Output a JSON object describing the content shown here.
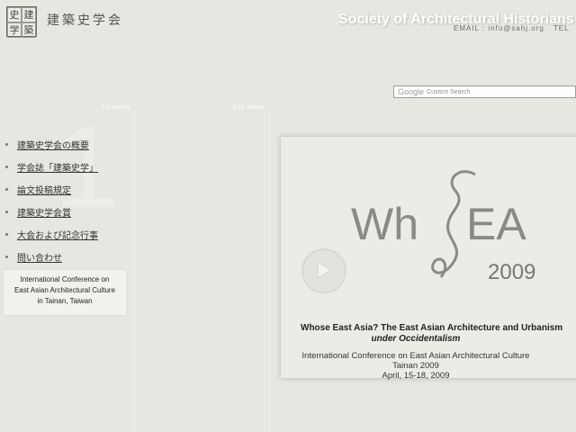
{
  "header": {
    "logo_chars": [
      "史",
      "建",
      "学",
      "築"
    ],
    "site_name": "建築史学会",
    "english_title": "Society of Architectural Historians",
    "email": "EMAIL : info@sahj.org",
    "tel_label": "TEL"
  },
  "search": {
    "brand": "Google",
    "placeholder": "Custom Search"
  },
  "menus": {
    "first_label": "1st menu",
    "second_label": "2nd menu",
    "big_number": "1"
  },
  "nav": {
    "items": [
      "建築史学会の概要",
      "学会誌「建築史学」",
      "論文投稿規定",
      "建築史学会賞",
      "大会および記念行事",
      "問い合わせ"
    ]
  },
  "conference_box": {
    "line1": "International Conference on",
    "line2": "East Asian Architectural Culture",
    "line3": "in Tainan, Taiwan"
  },
  "banner": {
    "logo_text_left": "Wh",
    "logo_text_right": "EA",
    "logo_year": "2009",
    "title": "Whose East Asia? The East Asian Architecture and Urbanism",
    "subtitle_prefix": "under ",
    "subtitle_em": "Occidentalism",
    "info_line1": "International Conference on East Asian Architectural Culture",
    "info_line2": "Tainan 2009",
    "info_line3": "April, 15-18, 2009"
  },
  "colors": {
    "background": "#e8e6e0",
    "banner_bg": "#ecebe6",
    "logo_gray": "#8a8a86"
  }
}
